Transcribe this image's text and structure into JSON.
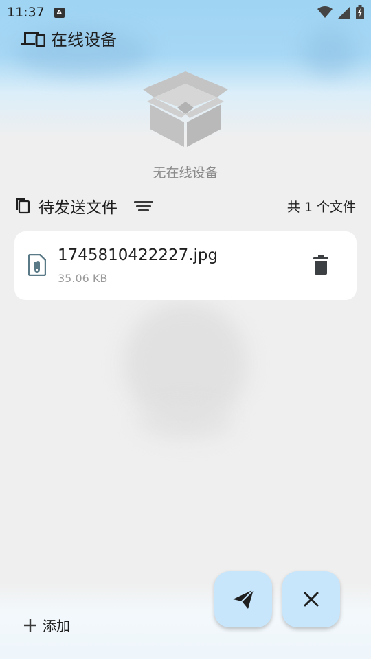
{
  "status_bar": {
    "time": "11:37",
    "notification_badge": "A",
    "icons": [
      "wifi-icon",
      "signal-icon",
      "battery-charging-icon"
    ]
  },
  "devices": {
    "title": "在线设备",
    "icon": "devices-icon",
    "empty_text": "无在线设备"
  },
  "pending": {
    "title": "待发送文件",
    "count_text": "共 1 个文件"
  },
  "files": [
    {
      "name": "1745810422227.jpg",
      "size": "35.06 KB"
    }
  ],
  "actions": {
    "add_label": "添加",
    "send_icon": "send-icon",
    "close_icon": "close-icon"
  },
  "colors": {
    "accent": "#c7e6fb",
    "file_icon": "#5b7a87",
    "icon_dark": "#3c4043"
  }
}
